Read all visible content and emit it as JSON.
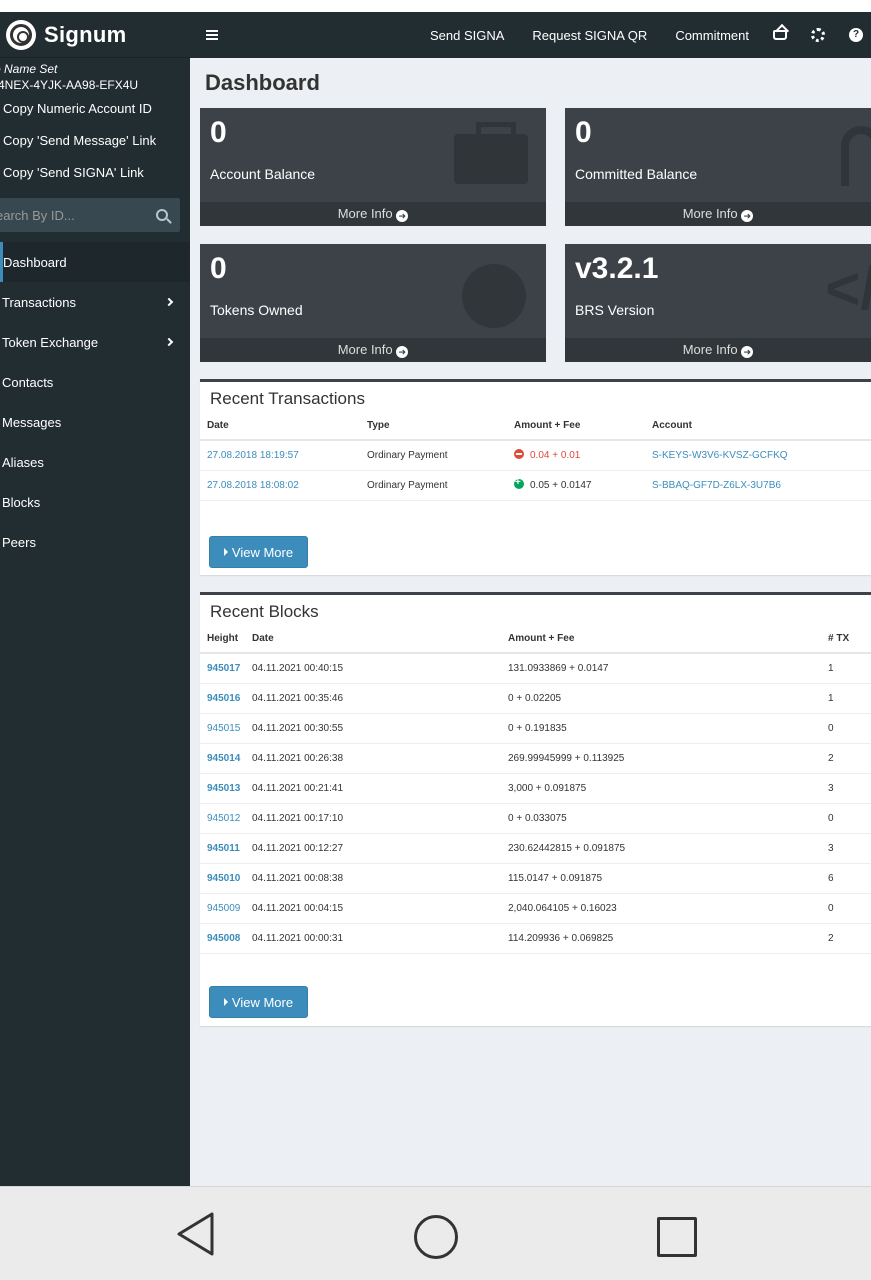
{
  "brand": {
    "name": "Signum"
  },
  "account": {
    "name": "o Name Set",
    "address": "4NEX-4YJK-AA98-EFX4U",
    "links": [
      "Copy Numeric Account ID",
      "Copy 'Send Message' Link",
      "Copy 'Send SIGNA' Link"
    ]
  },
  "search": {
    "placeholder": "earch By ID..."
  },
  "nav": [
    {
      "label": "Dashboard",
      "active": true,
      "expand": false
    },
    {
      "label": "Transactions",
      "expand": true
    },
    {
      "label": "Token Exchange",
      "expand": true
    },
    {
      "label": "Contacts",
      "expand": false
    },
    {
      "label": "Messages",
      "expand": false
    },
    {
      "label": "Aliases",
      "expand": false
    },
    {
      "label": "Blocks",
      "expand": false
    },
    {
      "label": "Peers",
      "expand": false
    }
  ],
  "topbar": {
    "links": [
      "Send SIGNA",
      "Request SIGNA QR",
      "Commitment"
    ],
    "icons": [
      "mail-icon",
      "gears-icon",
      "help-icon"
    ]
  },
  "page_title": "Dashboard",
  "stats": [
    {
      "value": "0",
      "label": "Account Balance",
      "more": "More Info",
      "icon": "briefcase-icon"
    },
    {
      "value": "0",
      "label": "Committed Balance",
      "more": "More Info",
      "icon": "lock-icon"
    },
    {
      "value": "0",
      "label": "Tokens Owned",
      "more": "More Info",
      "icon": "pie-chart-icon"
    },
    {
      "value": "v3.2.1",
      "label": "BRS Version",
      "more": "More Info",
      "icon": "code-icon"
    }
  ],
  "recent_transactions": {
    "title": "Recent Transactions",
    "columns": [
      "Date",
      "Type",
      "Amount + Fee",
      "Account"
    ],
    "rows": [
      {
        "date": "27.08.2018 18:19:57",
        "type": "Ordinary Payment",
        "sign": "neg",
        "amount": "0.04 + 0.01",
        "account": "S-KEYS-W3V6-KVSZ-GCFKQ"
      },
      {
        "date": "27.08.2018 18:08:02",
        "type": "Ordinary Payment",
        "sign": "pos",
        "amount": "0.05",
        "fee": " + 0.0147",
        "account": "S-BBAQ-GF7D-Z6LX-3U7B6"
      }
    ],
    "view_more": "View More"
  },
  "recent_blocks": {
    "title": "Recent Blocks",
    "columns": [
      "Height",
      "Date",
      "Amount + Fee",
      "# TX"
    ],
    "rows": [
      {
        "height": "945017",
        "date": "04.11.2021 00:40:15",
        "amount": "131.0933869 + 0.0147",
        "tx": "1",
        "bold": true
      },
      {
        "height": "945016",
        "date": "04.11.2021 00:35:46",
        "amount": "0 + 0.02205",
        "tx": "1",
        "bold": true
      },
      {
        "height": "945015",
        "date": "04.11.2021 00:30:55",
        "amount": "0 + 0.191835",
        "tx": "0",
        "bold": false
      },
      {
        "height": "945014",
        "date": "04.11.2021 00:26:38",
        "amount": "269.99945999 + 0.113925",
        "tx": "2",
        "bold": true
      },
      {
        "height": "945013",
        "date": "04.11.2021 00:21:41",
        "amount": "3,000 + 0.091875",
        "tx": "3",
        "bold": true
      },
      {
        "height": "945012",
        "date": "04.11.2021 00:17:10",
        "amount": "0 + 0.033075",
        "tx": "0",
        "bold": false
      },
      {
        "height": "945011",
        "date": "04.11.2021 00:12:27",
        "amount": "230.62442815 + 0.091875",
        "tx": "3",
        "bold": true
      },
      {
        "height": "945010",
        "date": "04.11.2021 00:08:38",
        "amount": "115.0147 + 0.091875",
        "tx": "6",
        "bold": true
      },
      {
        "height": "945009",
        "date": "04.11.2021 00:04:15",
        "amount": "2,040.064105 + 0.16023",
        "tx": "0",
        "bold": false
      },
      {
        "height": "945008",
        "date": "04.11.2021 00:00:31",
        "amount": "114.209936 + 0.069825",
        "tx": "2",
        "bold": true
      }
    ],
    "view_more": "View More"
  },
  "android_nav": [
    "back-icon",
    "home-icon",
    "recents-icon"
  ]
}
